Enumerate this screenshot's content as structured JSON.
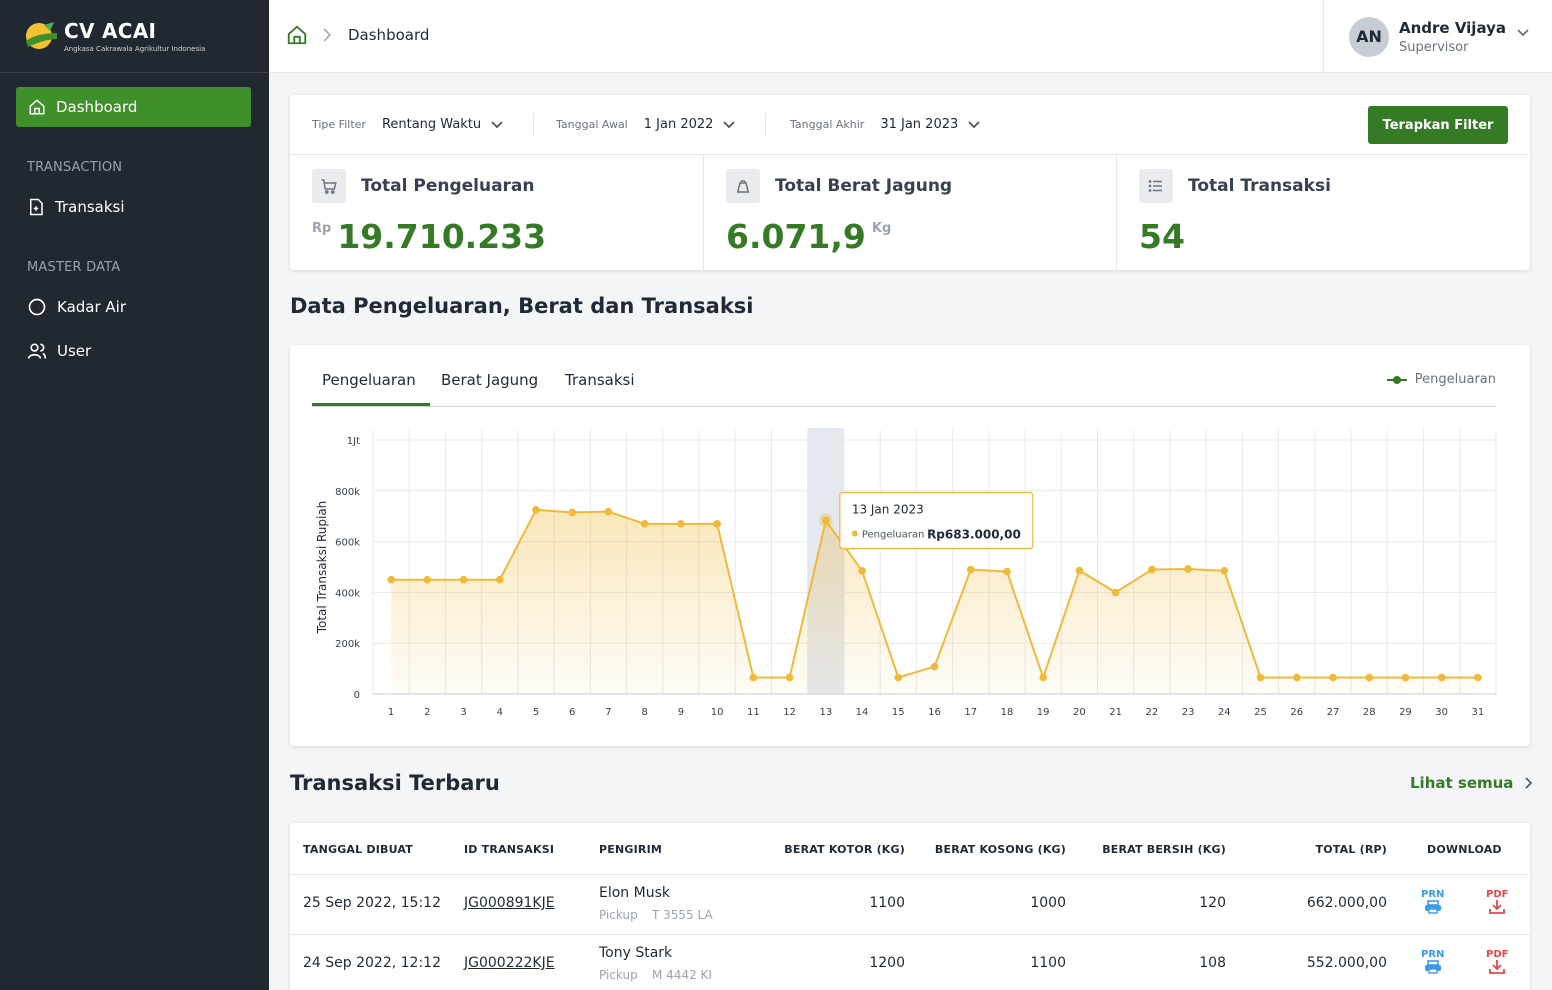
{
  "brand": {
    "name": "CV ACAI",
    "tagline": "Angkasa Cakrawala Agrikultur Indonesia"
  },
  "sidebar": {
    "active_item": "Dashboard",
    "sections": [
      {
        "title": "TRANSACTION",
        "items": [
          "Transaksi"
        ]
      },
      {
        "title": "MASTER DATA",
        "items": [
          "Kadar Air",
          "User"
        ]
      }
    ]
  },
  "breadcrumb": {
    "current": "Dashboard"
  },
  "user": {
    "initials": "AN",
    "name": "Andre Vijaya",
    "role": "Supervisor"
  },
  "filter": {
    "type_label": "Tipe Filter",
    "type_value": "Rentang Waktu",
    "start_label": "Tanggal Awal",
    "start_value": "1 Jan 2022",
    "end_label": "Tanggal Akhir",
    "end_value": "31 Jan 2023",
    "apply_label": "Terapkan Filter"
  },
  "stats": [
    {
      "title": "Total Pengeluaran",
      "prefix": "Rp",
      "value": "19.710.233",
      "suffix": ""
    },
    {
      "title": "Total Berat Jagung",
      "prefix": "",
      "value": "6.071,9",
      "suffix": "Kg"
    },
    {
      "title": "Total Transaksi",
      "prefix": "",
      "value": "54",
      "suffix": ""
    }
  ],
  "chart_section_title": "Data Pengeluaran, Berat dan Transaksi",
  "chart_tabs": [
    "Pengeluaran",
    "Berat Jagung",
    "Transaksi"
  ],
  "active_chart_tab": "Pengeluaran",
  "tooltip": {
    "date": "13 Jan 2023",
    "series": "Pengeluaran",
    "value": "Rp683.000,00"
  },
  "chart_data": {
    "type": "area",
    "ylabel": "Total Transaksi Rupiah",
    "ylim": [
      0,
      1000000
    ],
    "yticks": [
      "0",
      "200k",
      "400k",
      "600k",
      "800k",
      "1Jt"
    ],
    "x": [
      1,
      2,
      3,
      4,
      5,
      6,
      7,
      8,
      9,
      10,
      11,
      12,
      13,
      14,
      15,
      16,
      17,
      18,
      19,
      20,
      21,
      22,
      23,
      24,
      25,
      26,
      27,
      28,
      29,
      30,
      31
    ],
    "series": [
      {
        "name": "Pengeluaran",
        "color": "#f0b93a",
        "values": [
          450000,
          450000,
          450000,
          450000,
          725000,
          715000,
          718000,
          670000,
          670000,
          670000,
          65000,
          65000,
          683000,
          485000,
          65000,
          108000,
          490000,
          482000,
          65000,
          486000,
          400000,
          490000,
          492000,
          485000,
          65000,
          65000,
          65000,
          65000,
          65000,
          65000,
          65000
        ]
      }
    ],
    "highlight_x": 13,
    "legend": "top-right",
    "grid": true
  },
  "table_section_title": "Transaksi Terbaru",
  "see_all_label": "Lihat semua",
  "table": {
    "headers": [
      "TANGGAL DIBUAT",
      "ID TRANSAKSI",
      "PENGIRIM",
      "BERAT KOTOR (KG)",
      "BERAT KOSONG (KG)",
      "BERAT BERSIH (KG)",
      "TOTAL (RP)",
      "DOWNLOAD"
    ],
    "rows": [
      {
        "date": "25 Sep 2022, 15:12",
        "id": "JG000891KJE",
        "sender": "Elon Musk",
        "vehicle_type": "Pickup",
        "plate": "T 3555 LA",
        "gross": "1100",
        "empty": "1000",
        "net": "120",
        "total": "662.000,00"
      },
      {
        "date": "24 Sep 2022, 12:12",
        "id": "JG000222KJE",
        "sender": "Tony Stark",
        "vehicle_type": "Pickup",
        "plate": "M 4442 KI",
        "gross": "1200",
        "empty": "1100",
        "net": "108",
        "total": "552.000,00"
      }
    ],
    "download_labels": [
      "PRN",
      "PDF"
    ]
  }
}
